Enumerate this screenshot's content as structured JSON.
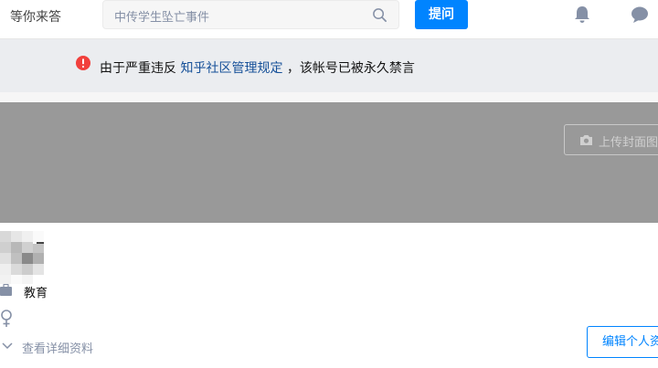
{
  "header": {
    "nav_partial": "等你来答",
    "search_placeholder": "中传学生坠亡事件",
    "ask_button": "提问",
    "icons": [
      "search-icon",
      "bell-icon",
      "message-icon"
    ],
    "accent_color": "#0084ff"
  },
  "notice": {
    "text_before": "由于严重违反 ",
    "link_text": "知乎社区管理规定",
    "text_after": " ，该帐号已被永久禁言",
    "icon": "alert-icon",
    "icon_color": "#f1403c"
  },
  "cover": {
    "upload_button": "上传封面图"
  },
  "profile": {
    "industry": "教育",
    "gender_icon": "female-icon",
    "expand_label": "查看详细资料",
    "edit_button": "编辑个人资料"
  }
}
